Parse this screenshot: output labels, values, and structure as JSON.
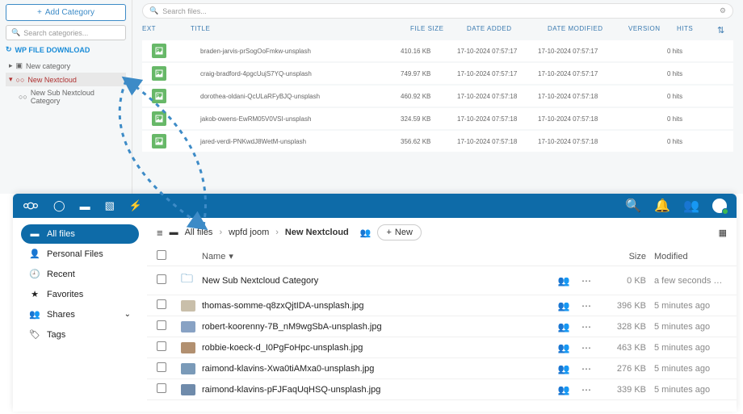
{
  "wp": {
    "add_category": "Add Category",
    "search_placeholder": "Search categories...",
    "download_title": "WP FILE DOWNLOAD",
    "tree": {
      "new_category": "New category",
      "new_nextcloud": "New Nextcloud",
      "new_sub": "New Sub Nextcloud Category"
    },
    "search_files": "Search files...",
    "columns": {
      "ext": "EXT",
      "title": "TITLE",
      "fs": "FILE SIZE",
      "da": "DATE ADDED",
      "dm": "DATE MODIFIED",
      "ver": "VERSION",
      "hits": "HITS"
    },
    "rows": [
      {
        "title": "braden-jarvis-prSogOoFmkw-unsplash",
        "fs": "410.16 KB",
        "da": "17-10-2024 07:57:17",
        "dm": "17-10-2024 07:57:17",
        "hits": "0 hits"
      },
      {
        "title": "craig-bradford-4pgcUujS7YQ-unsplash",
        "fs": "749.97 KB",
        "da": "17-10-2024 07:57:17",
        "dm": "17-10-2024 07:57:17",
        "hits": "0 hits"
      },
      {
        "title": "dorothea-oldani-QcULaRFyBJQ-unsplash",
        "fs": "460.92 KB",
        "da": "17-10-2024 07:57:18",
        "dm": "17-10-2024 07:57:18",
        "hits": "0 hits"
      },
      {
        "title": "jakob-owens-EwRM05V0VSI-unsplash",
        "fs": "324.59 KB",
        "da": "17-10-2024 07:57:18",
        "dm": "17-10-2024 07:57:18",
        "hits": "0 hits"
      },
      {
        "title": "jared-verdi-PNKwdJ8WetM-unsplash",
        "fs": "356.62 KB",
        "da": "17-10-2024 07:57:18",
        "dm": "17-10-2024 07:57:18",
        "hits": "0 hits"
      }
    ]
  },
  "nc": {
    "sidebar": {
      "all_files": "All files",
      "personal": "Personal Files",
      "recent": "Recent",
      "favorites": "Favorites",
      "shares": "Shares",
      "tags": "Tags"
    },
    "crumbs": {
      "all": "All files",
      "wpfd": "wpfd joom",
      "curr": "New Nextcloud"
    },
    "new_btn": "New",
    "thead": {
      "name": "Name",
      "size": "Size",
      "modified": "Modified"
    },
    "rows": [
      {
        "name": "New Sub Nextcloud Category",
        "size": "0 KB",
        "mod": "a few seconds …",
        "folder": true,
        "thumb": "#0e6ba8"
      },
      {
        "name": "thomas-somme-q8zxQjtIDA-unsplash.jpg",
        "size": "396 KB",
        "mod": "5 minutes ago",
        "folder": false,
        "thumb": "#c9bfaa"
      },
      {
        "name": "robert-koorenny-7B_nM9wgSbA-unsplash.jpg",
        "size": "328 KB",
        "mod": "5 minutes ago",
        "folder": false,
        "thumb": "#88a2c4"
      },
      {
        "name": "robbie-koeck-d_I0PgFoHpc-unsplash.jpg",
        "size": "463 KB",
        "mod": "5 minutes ago",
        "folder": false,
        "thumb": "#b29070"
      },
      {
        "name": "raimond-klavins-Xwa0tiAMxa0-unsplash.jpg",
        "size": "276 KB",
        "mod": "5 minutes ago",
        "folder": false,
        "thumb": "#7a9ab8"
      },
      {
        "name": "raimond-klavins-pFJFaqUqHSQ-unsplash.jpg",
        "size": "339 KB",
        "mod": "5 minutes ago",
        "folder": false,
        "thumb": "#6f8bab"
      }
    ]
  }
}
